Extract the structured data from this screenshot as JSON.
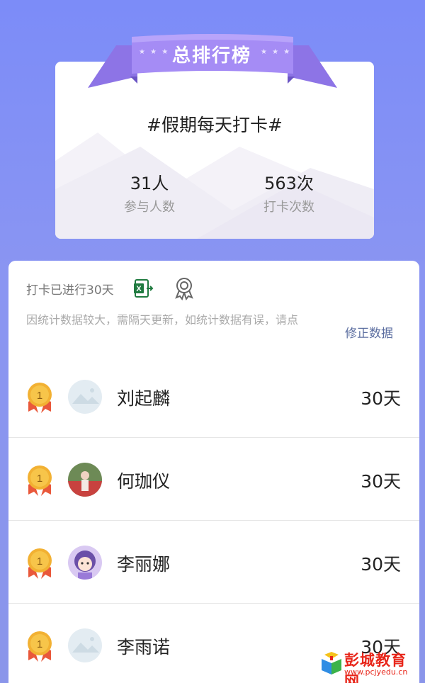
{
  "header": {
    "banner_title": "总排行榜",
    "event_title": "#假期每天打卡#",
    "stats": [
      {
        "value": "31人",
        "label": "参与人数"
      },
      {
        "value": "563次",
        "label": "打卡次数"
      }
    ]
  },
  "summary": {
    "days_text": "打卡已进行30天",
    "icons": [
      "excel-export-icon",
      "award-icon"
    ],
    "notice": "因统计数据较大，需隔天更新，如统计数据有误，请点",
    "fix_link": "修正数据"
  },
  "ranking": [
    {
      "rank": "1",
      "name": "刘起麟",
      "days": "30天",
      "avatar": "placeholder"
    },
    {
      "rank": "1",
      "name": "何珈仪",
      "days": "30天",
      "avatar": "photo"
    },
    {
      "rank": "1",
      "name": "李丽娜",
      "days": "30天",
      "avatar": "cartoon"
    },
    {
      "rank": "1",
      "name": "李雨诺",
      "days": "30天",
      "avatar": "placeholder"
    }
  ],
  "watermark": {
    "text": "彭城教育网",
    "url": "www.pcjyedu.cn"
  },
  "colors": {
    "background": "#7d8ef7",
    "ribbon": "#9b82f0",
    "medal_gold": "#f2b133",
    "medal_ribbon": "#e9583b",
    "link": "#5d6fa1"
  }
}
